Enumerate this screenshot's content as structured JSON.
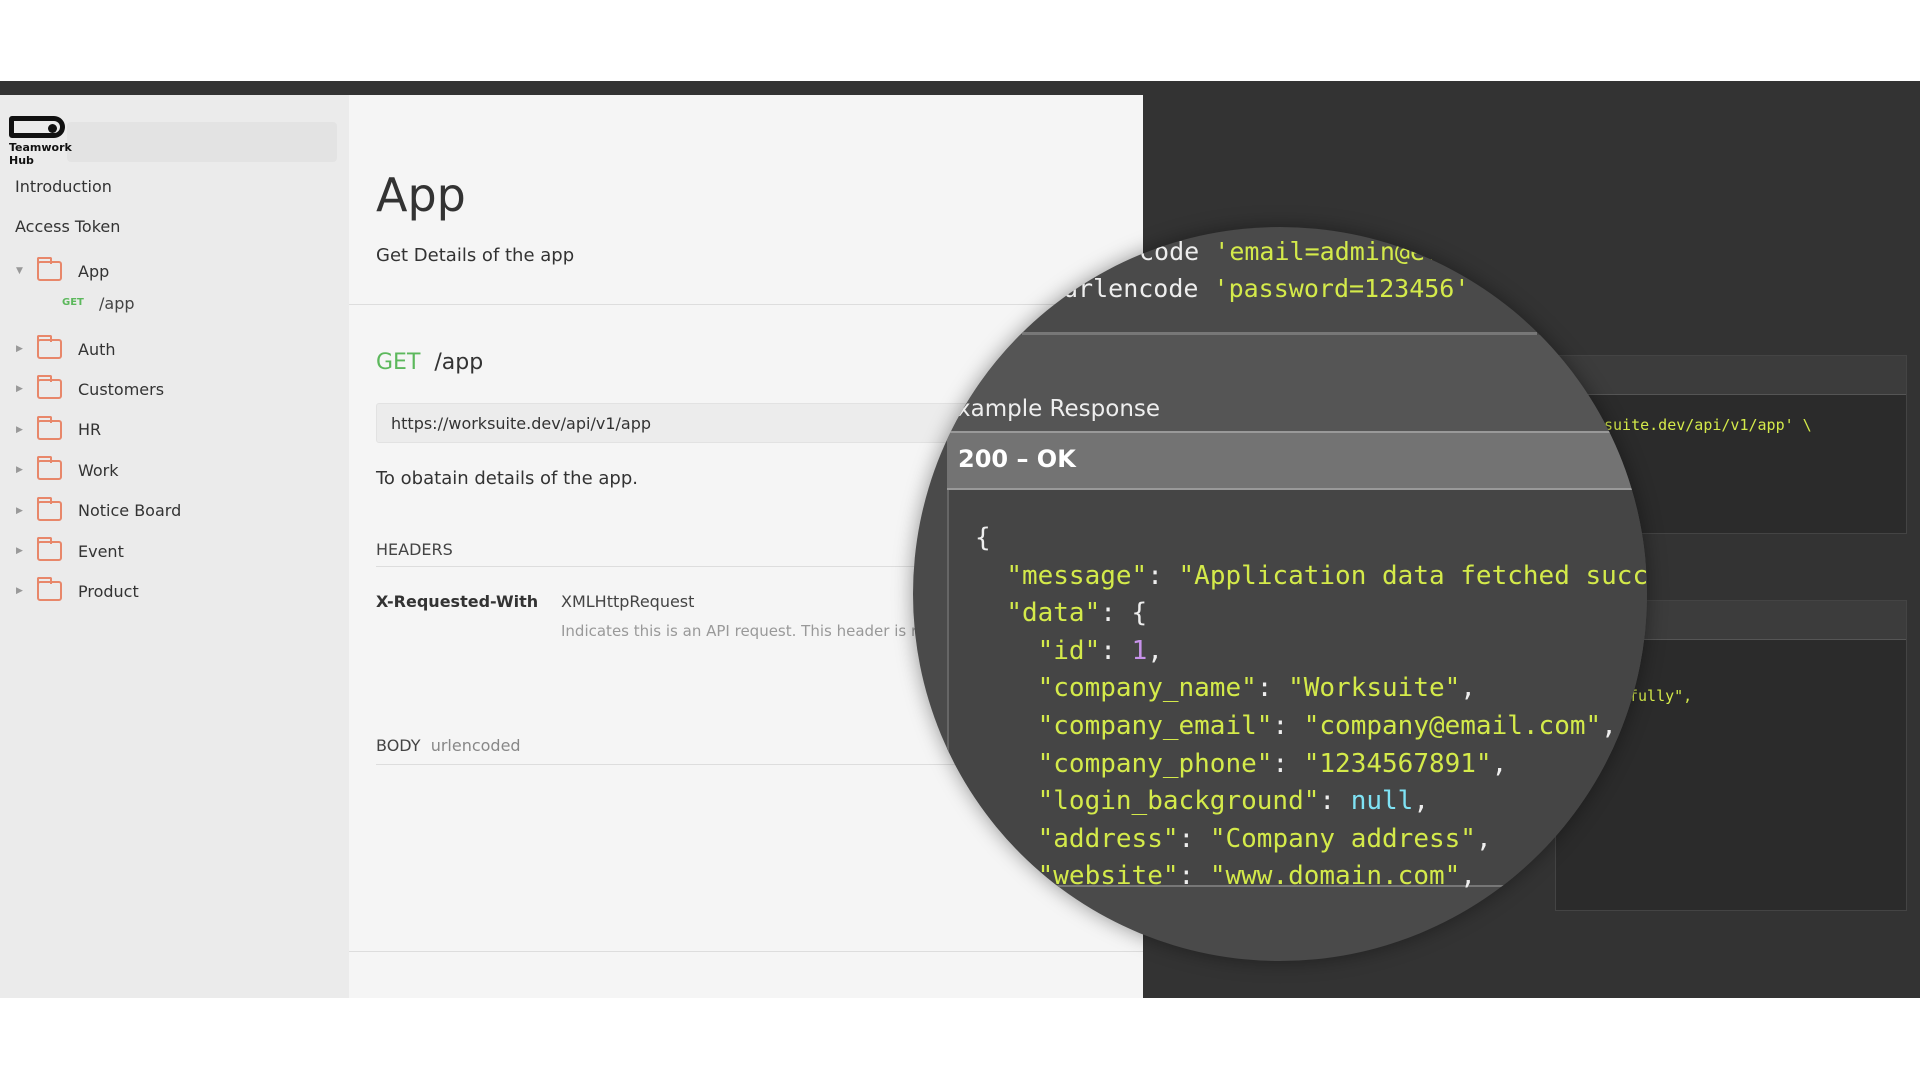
{
  "logo": {
    "line1": "Teamwork",
    "line2": "Hub"
  },
  "sidebar": {
    "top_items": [
      "Introduction",
      "Access Token"
    ],
    "folders": [
      {
        "label": "App",
        "expanded": true,
        "endpoints": [
          {
            "method": "GET",
            "path": "/app"
          }
        ]
      },
      {
        "label": "Auth"
      },
      {
        "label": "Customers"
      },
      {
        "label": "HR"
      },
      {
        "label": "Work"
      },
      {
        "label": "Notice Board"
      },
      {
        "label": "Event"
      },
      {
        "label": "Product"
      }
    ]
  },
  "main": {
    "title": "App",
    "subtitle": "Get Details of the app",
    "method": "GET",
    "path": "/app",
    "url": "https://worksuite.dev/api/v1/app",
    "description": "To obatain details of the app.",
    "headers_label": "HEADERS",
    "header_name": "X-Requested-With",
    "header_value": "XMLHttpRequest",
    "header_desc": "Indicates this is an API request. This header is r",
    "body_label": "BODY",
    "body_type": "urlencoded"
  },
  "dark_panel": {
    "curl_url_fragment": "suite.dev/api/v1/app' \\",
    "response_fragment": "fully\","
  },
  "magnifier": {
    "curl_line1_kw": "code",
    "curl_line1_val": "'email=admin@e.",
    "curl_line2_kw": "urlencode",
    "curl_line2_val": "'password=123456'",
    "example_label": "xample Response",
    "status": "200 – OK",
    "json": {
      "open": "{",
      "message_key": "\"message\"",
      "message_val": "\"Application data fetched successfu",
      "data_key": "\"data\"",
      "id_key": "\"id\"",
      "id_val": "1",
      "company_name_key": "\"company_name\"",
      "company_name_val": "\"Worksuite\"",
      "company_email_key": "\"company_email\"",
      "company_email_val": "\"company@email.com\"",
      "company_phone_key": "\"company_phone\"",
      "company_phone_val": "\"1234567891\"",
      "login_background_key": "\"login_background\"",
      "login_background_val": "null",
      "address_key": "\"address\"",
      "address_val": "\"Company address\"",
      "website_key": "\"website\"",
      "website_val": "\"www.domain.com\""
    }
  },
  "colors": {
    "get": "#5cb85c",
    "folder": "#e8876a",
    "code_string": "#d4ea4a",
    "code_number": "#c792ea",
    "code_null": "#7fe3f5"
  }
}
